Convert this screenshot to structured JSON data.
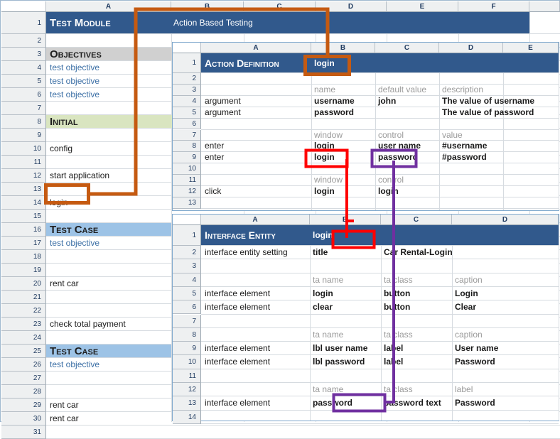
{
  "colors": {
    "header_blue": "#31598c",
    "objectives_gray": "#d0d0d0",
    "initial_green": "#d9e5c0",
    "testcase_blue": "#9dc3e6",
    "highlight_orange": "#c55a11",
    "highlight_red": "#ff0000",
    "highlight_purple": "#7030a0",
    "link_text_blue": "#3a6ea5",
    "muted_gray": "#9a9a9a"
  },
  "main_sheet": {
    "name": "test-module-sheet",
    "columns": [
      "A",
      "B",
      "C",
      "D",
      "E",
      "F"
    ],
    "row_numbers": [
      "1",
      "2",
      "3",
      "4",
      "5",
      "6",
      "7",
      "8",
      "9",
      "10",
      "11",
      "12",
      "13",
      "14",
      "15",
      "16",
      "17",
      "18",
      "19",
      "20",
      "21",
      "22",
      "23",
      "24",
      "25",
      "26",
      "27",
      "28",
      "29",
      "30",
      "31"
    ],
    "rows": [
      {
        "n": "1",
        "band": "header",
        "a": "Test Module",
        "b": "Action Based Testing"
      },
      {
        "n": "2",
        "band": "none",
        "a": "",
        "b": ""
      },
      {
        "n": "3",
        "band": "gray",
        "a": "Objectives",
        "b": ""
      },
      {
        "n": "4",
        "band": "none",
        "a": "test objective",
        "style": "blue"
      },
      {
        "n": "5",
        "band": "none",
        "a": "test objective",
        "style": "blue"
      },
      {
        "n": "6",
        "band": "none",
        "a": "test objective",
        "style": "blue"
      },
      {
        "n": "7",
        "band": "none",
        "a": ""
      },
      {
        "n": "8",
        "band": "green",
        "a": "Initial"
      },
      {
        "n": "9",
        "band": "none",
        "a": ""
      },
      {
        "n": "10",
        "band": "none",
        "a": "config"
      },
      {
        "n": "11",
        "band": "none",
        "a": ""
      },
      {
        "n": "12",
        "band": "none",
        "a": "start application"
      },
      {
        "n": "13",
        "band": "none",
        "a": ""
      },
      {
        "n": "14",
        "band": "none",
        "a": "login"
      },
      {
        "n": "15",
        "band": "none",
        "a": ""
      },
      {
        "n": "16",
        "band": "tcblue",
        "a": "Test Case"
      },
      {
        "n": "17",
        "band": "none",
        "a": "test objective",
        "style": "blue"
      },
      {
        "n": "18",
        "band": "none",
        "a": ""
      },
      {
        "n": "19",
        "band": "none",
        "a": ""
      },
      {
        "n": "20",
        "band": "none",
        "a": "rent car"
      },
      {
        "n": "21",
        "band": "none",
        "a": ""
      },
      {
        "n": "22",
        "band": "none",
        "a": ""
      },
      {
        "n": "23",
        "band": "none",
        "a": "check total payment"
      },
      {
        "n": "24",
        "band": "none",
        "a": ""
      },
      {
        "n": "25",
        "band": "tcblue",
        "a": "Test Case"
      },
      {
        "n": "26",
        "band": "none",
        "a": "test objective",
        "style": "blue"
      },
      {
        "n": "27",
        "band": "none",
        "a": ""
      },
      {
        "n": "28",
        "band": "none",
        "a": ""
      },
      {
        "n": "29",
        "band": "none",
        "a": "rent car"
      },
      {
        "n": "30",
        "band": "none",
        "a": "rent car"
      },
      {
        "n": "31",
        "band": "none",
        "a": ""
      }
    ]
  },
  "action_panel": {
    "name": "action-definition-panel",
    "columns": [
      "A",
      "B",
      "C",
      "D",
      "E"
    ],
    "row_numbers": [
      "1",
      "2",
      "3",
      "4",
      "5",
      "6",
      "7",
      "8",
      "9",
      "10",
      "11",
      "12",
      "13"
    ],
    "title": "Action Definition",
    "title_value": "login",
    "rows": [
      {
        "n": "1",
        "a": "Action Definition",
        "b": "login",
        "c": "",
        "d": "",
        "band": "header"
      },
      {
        "n": "2",
        "a": "",
        "b": "",
        "c": "",
        "d": ""
      },
      {
        "n": "3",
        "a": "",
        "b": "name",
        "c": "default value",
        "d": "description",
        "muted": true
      },
      {
        "n": "4",
        "a": "argument",
        "b": "username",
        "c": "john",
        "d": "The value of username"
      },
      {
        "n": "5",
        "a": "argument",
        "b": "password",
        "c": "",
        "d": "The value of password"
      },
      {
        "n": "6",
        "a": "",
        "b": "",
        "c": "",
        "d": ""
      },
      {
        "n": "7",
        "a": "",
        "b": "window",
        "c": "control",
        "d": "value",
        "muted": true
      },
      {
        "n": "8",
        "a": "enter",
        "b": "login",
        "c": "user name",
        "d": "#username"
      },
      {
        "n": "9",
        "a": "enter",
        "b": "login",
        "c": "password",
        "d": "#password"
      },
      {
        "n": "10",
        "a": "",
        "b": "",
        "c": "",
        "d": ""
      },
      {
        "n": "11",
        "a": "",
        "b": "window",
        "c": "control",
        "d": "",
        "muted": true
      },
      {
        "n": "12",
        "a": "click",
        "b": "login",
        "c": "login",
        "d": ""
      },
      {
        "n": "13",
        "a": "",
        "b": "",
        "c": "",
        "d": ""
      }
    ]
  },
  "interface_panel": {
    "name": "interface-entity-panel",
    "columns": [
      "A",
      "B",
      "C",
      "D"
    ],
    "row_numbers": [
      "1",
      "2",
      "3",
      "4",
      "5",
      "6",
      "7",
      "8",
      "9",
      "10",
      "11",
      "12",
      "13",
      "14"
    ],
    "title": "Interface Entity",
    "title_value": "login",
    "rows": [
      {
        "n": "1",
        "a": "Interface Entity",
        "b": "login",
        "c": "",
        "d": "",
        "band": "header"
      },
      {
        "n": "2",
        "a": "interface entity setting",
        "b": "title",
        "c": "Car Rental-Login",
        "d": ""
      },
      {
        "n": "3",
        "a": "",
        "b": "",
        "c": "",
        "d": ""
      },
      {
        "n": "4",
        "a": "",
        "b": "ta name",
        "c": "ta class",
        "d": "caption",
        "muted": true
      },
      {
        "n": "5",
        "a": "interface element",
        "b": "login",
        "c": "button",
        "d": "Login"
      },
      {
        "n": "6",
        "a": "interface element",
        "b": "clear",
        "c": "button",
        "d": "Clear"
      },
      {
        "n": "7",
        "a": "",
        "b": "",
        "c": "",
        "d": ""
      },
      {
        "n": "8",
        "a": "",
        "b": "ta name",
        "c": "ta class",
        "d": "caption",
        "muted": true
      },
      {
        "n": "9",
        "a": "interface element",
        "b": "lbl user name",
        "c": "label",
        "d": "User name"
      },
      {
        "n": "10",
        "a": "interface element",
        "b": "lbl password",
        "c": "label",
        "d": "Password"
      },
      {
        "n": "11",
        "a": "",
        "b": "",
        "c": "",
        "d": ""
      },
      {
        "n": "12",
        "a": "",
        "b": "ta name",
        "c": "ta class",
        "d": "label",
        "muted": true
      },
      {
        "n": "13",
        "a": "interface element",
        "b": "password",
        "c": "password text",
        "d": "Password"
      },
      {
        "n": "14",
        "a": "",
        "b": "",
        "c": "",
        "d": ""
      }
    ]
  },
  "annotations": {
    "orange": {
      "label": "orange-trace-login-action",
      "from": "main_sheet.A14 (login)",
      "to": "action_panel.B1 (login)"
    },
    "red": {
      "label": "red-trace-login-window",
      "from": "action_panel.B9 (login)",
      "to": "interface_panel.B1 (login)"
    },
    "purple": {
      "label": "purple-trace-password-control",
      "from": "action_panel.C9 (password)",
      "to": "interface_panel.B13 (password)"
    }
  }
}
